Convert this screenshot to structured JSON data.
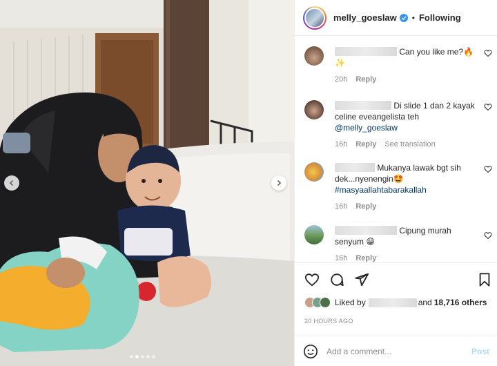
{
  "post": {
    "username": "melly_goeslaw",
    "separator": "•",
    "follow_status": "Following"
  },
  "carousel": {
    "total_dots": 5,
    "active_dot": 1
  },
  "comments": [
    {
      "text": "Can you like me?🔥",
      "second_line": "✨",
      "time": "20h",
      "reply": "Reply"
    },
    {
      "text": "Di slide 1 dan 2 kayak celine eveangelista teh",
      "mention": "@melly_goeslaw",
      "time": "16h",
      "reply": "Reply",
      "translate": "See translation"
    },
    {
      "text": "Mukanya lawak bgt sih dek...nyenengin🤩",
      "hashtag": "#masyaallahtabarakallah",
      "time": "16h",
      "reply": "Reply"
    },
    {
      "text": "Cipung murah senyum 😁",
      "time": "16h",
      "reply": "Reply"
    }
  ],
  "likes": {
    "prefix": "Liked by",
    "suffix": "and",
    "count": "18,716 others"
  },
  "timestamp": "20 HOURS AGO",
  "composer": {
    "placeholder": "Add a comment...",
    "post_label": "Post"
  },
  "icons": {
    "verified": "verified-badge-icon",
    "like": "heart-icon",
    "comment": "comment-bubble-icon",
    "share": "paper-plane-icon",
    "save": "bookmark-icon",
    "emoji": "smiley-icon"
  },
  "colors": {
    "verified": "#3897f0",
    "link": "#00376b",
    "muted": "#8e8e8e",
    "post_disabled": "#b3dbff"
  }
}
